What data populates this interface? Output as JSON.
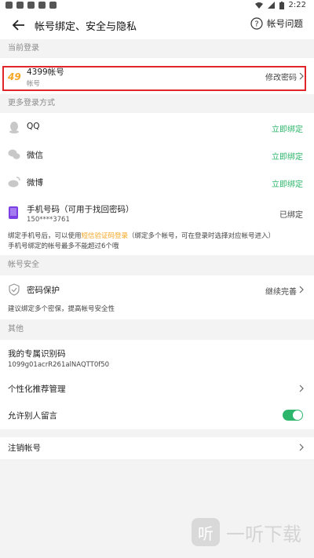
{
  "status_bar": {
    "time": "2:22"
  },
  "header": {
    "title": "帐号绑定、安全与隐私",
    "help_label": "帐号问题"
  },
  "sections": {
    "current_login": "当前登录",
    "more_login": "更多登录方式",
    "account_security": "帐号安全",
    "other": "其他"
  },
  "current_account": {
    "name": "4399帐号",
    "sub": "帐号",
    "action": "修改密码"
  },
  "login_methods": [
    {
      "label": "QQ",
      "action": "立即绑定",
      "icon": "qq-icon"
    },
    {
      "label": "微信",
      "action": "立即绑定",
      "icon": "wechat-icon"
    },
    {
      "label": "微博",
      "action": "立即绑定",
      "icon": "weibo-icon"
    }
  ],
  "phone": {
    "label": "手机号码（可用于找回密码）",
    "number": "150****3761",
    "status": "已绑定"
  },
  "phone_note": {
    "line1_a": "绑定手机号后，可以使用",
    "line1_link": "短信验证码登录",
    "line1_b": "（绑定多个帐号，可在登录时选择对应帐号进入）",
    "line2": "手机号绑定的帐号最多不能超过6个哦"
  },
  "password_protect": {
    "label": "密码保护",
    "action": "继续完善",
    "note": "建议绑定多个密保，提高帐号安全性"
  },
  "other": {
    "id_label": "我的专属识别码",
    "id_value": "1099g01acrR261alNAQTT0f50",
    "recommend_label": "个性化推荐管理",
    "allow_comment_label": "允许别人留言",
    "allow_comment_on": true,
    "cancel_label": "注销帐号"
  },
  "watermark": {
    "text": "一听下载"
  }
}
